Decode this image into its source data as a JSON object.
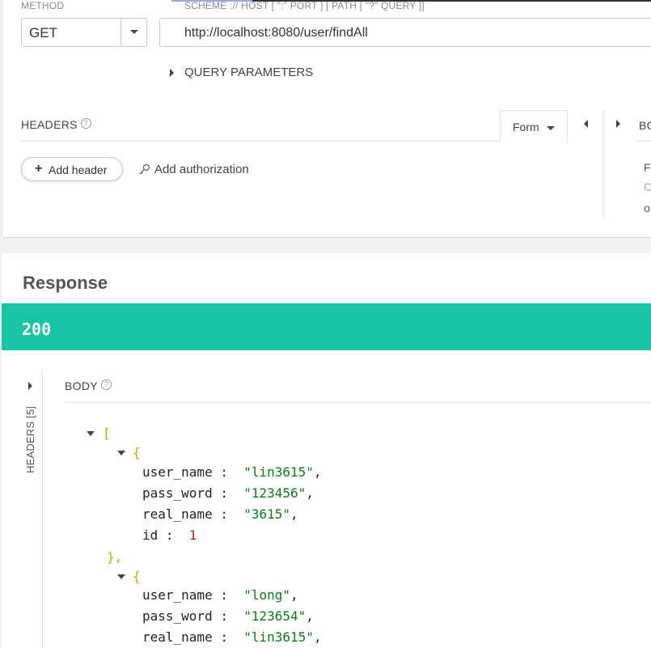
{
  "request": {
    "method_label": "METHOD",
    "method_value": "GET",
    "url_label": "SCHEME :// HOST [ \":\" PORT ] [ PATH [ \"?\" QUERY ]]",
    "url_value": "http://localhost:8080/user/findAll",
    "query_params_label": "QUERY PARAMETERS",
    "headers_label": "HEADERS",
    "help_glyph": "?",
    "form_label": "Form",
    "body_tab_label_cut": "BC",
    "add_header_label": "Add header",
    "add_authorization_label": "Add authorization",
    "cut_lines": [
      "F",
      "C",
      "o"
    ]
  },
  "response": {
    "title": "Response",
    "status": "200",
    "status_color": "#19c4a4",
    "headers_tab_label": "HEADERS [5]",
    "body_label": "BODY",
    "json": {
      "open_array": "[",
      "items": [
        {
          "open": "{",
          "fields": [
            {
              "key": "user_name",
              "value": "\"lin3615\"",
              "type": "string",
              "comma": ","
            },
            {
              "key": "pass_word",
              "value": "\"123456\"",
              "type": "string",
              "comma": ","
            },
            {
              "key": "real_name",
              "value": "\"3615\"",
              "type": "string",
              "comma": ","
            },
            {
              "key": "id",
              "value": "1",
              "type": "number",
              "comma": ""
            }
          ],
          "close": "},"
        },
        {
          "open": "{",
          "fields": [
            {
              "key": "user_name",
              "value": "\"long\"",
              "type": "string",
              "comma": ","
            },
            {
              "key": "pass_word",
              "value": "\"123654\"",
              "type": "string",
              "comma": ","
            },
            {
              "key": "real_name",
              "value": "\"lin3615\"",
              "type": "string",
              "comma": ","
            }
          ]
        }
      ]
    }
  }
}
